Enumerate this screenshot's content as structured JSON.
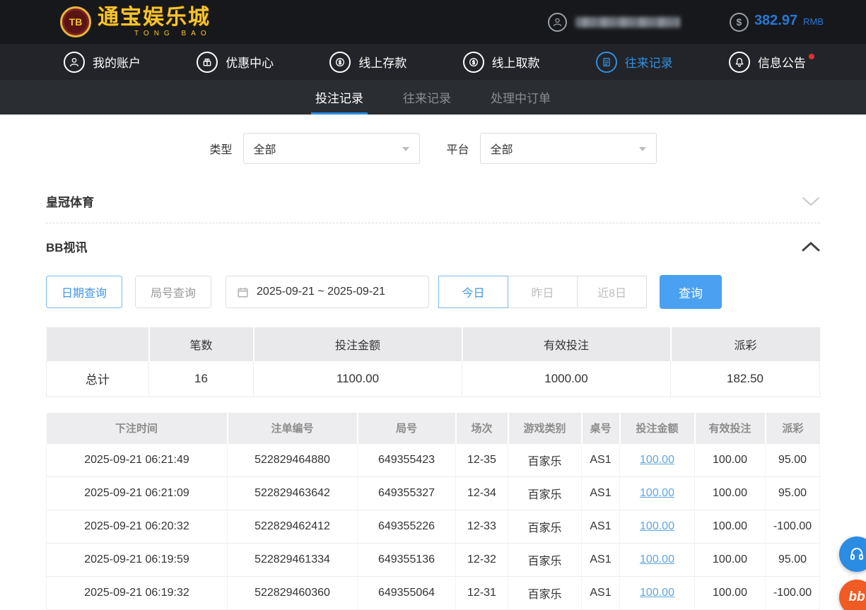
{
  "colors": {
    "accent_blue": "#2a8ce2",
    "button_blue": "#4ba1f1",
    "link_blue": "#5ea4dc",
    "negative_red": "#e24545",
    "logo_gold": "#f5c431"
  },
  "topbar": {
    "logo_badge": "TB",
    "logo_title": "通宝娱乐城",
    "logo_subtitle": "TONG BAO",
    "balance": "382.97",
    "currency": "RMB"
  },
  "nav": {
    "items": [
      {
        "label": "我的账户"
      },
      {
        "label": "优惠中心"
      },
      {
        "label": "线上存款"
      },
      {
        "label": "线上取款"
      },
      {
        "label": "往来记录"
      },
      {
        "label": "信息公告"
      }
    ]
  },
  "tabs": {
    "items": [
      {
        "label": "投注记录"
      },
      {
        "label": "往来记录"
      },
      {
        "label": "处理中订单"
      }
    ]
  },
  "filters": {
    "type_label": "类型",
    "type_value": "全部",
    "platform_label": "平台",
    "platform_value": "全部"
  },
  "sections": {
    "crown_sports": "皇冠体育",
    "bb_video": "BB视讯"
  },
  "query": {
    "date_query": "日期查询",
    "round_query": "局号查询",
    "date_range": "2025-09-21 ~ 2025-09-21",
    "today": "今日",
    "yesterday": "昨日",
    "last8days": "近8日",
    "search": "查询"
  },
  "summary": {
    "headers": [
      "",
      "笔数",
      "投注金额",
      "有效投注",
      "派彩"
    ],
    "row": [
      "总计",
      "16",
      "1100.00",
      "1000.00",
      "182.50"
    ]
  },
  "records": {
    "headers": [
      "下注时间",
      "注单编号",
      "局号",
      "场次",
      "游戏类别",
      "桌号",
      "投注金额",
      "有效投注",
      "派彩"
    ],
    "rows": [
      {
        "time": "2025-09-21 06:21:49",
        "order": "522829464880",
        "round": "649355423",
        "session": "12-35",
        "game": "百家乐",
        "table": "AS1",
        "bet": "100.00",
        "valid": "100.00",
        "payout": "95.00"
      },
      {
        "time": "2025-09-21 06:21:09",
        "order": "522829463642",
        "round": "649355327",
        "session": "12-34",
        "game": "百家乐",
        "table": "AS1",
        "bet": "100.00",
        "valid": "100.00",
        "payout": "95.00"
      },
      {
        "time": "2025-09-21 06:20:32",
        "order": "522829462412",
        "round": "649355226",
        "session": "12-33",
        "game": "百家乐",
        "table": "AS1",
        "bet": "100.00",
        "valid": "100.00",
        "payout": "-100.00"
      },
      {
        "time": "2025-09-21 06:19:59",
        "order": "522829461334",
        "round": "649355136",
        "session": "12-32",
        "game": "百家乐",
        "table": "AS1",
        "bet": "100.00",
        "valid": "100.00",
        "payout": "95.00"
      },
      {
        "time": "2025-09-21 06:19:32",
        "order": "522829460360",
        "round": "649355064",
        "session": "12-31",
        "game": "百家乐",
        "table": "AS1",
        "bet": "100.00",
        "valid": "100.00",
        "payout": "-100.00"
      }
    ]
  },
  "floating": {
    "bb_label": "bb"
  }
}
